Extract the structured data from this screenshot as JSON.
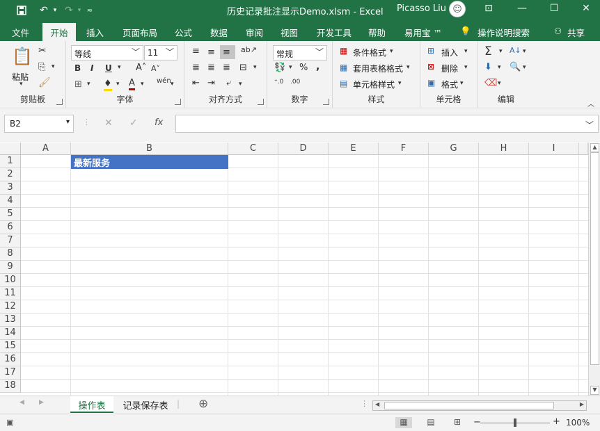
{
  "window": {
    "title": "历史记录批注显示Demo.xlsm  -  Excel",
    "user": "Picasso Liu",
    "controls": [
      "⊡",
      "—",
      "☐",
      "✕"
    ]
  },
  "qat": {
    "save_icon": "save-icon",
    "undo_icon": "undo-icon",
    "redo_icon": "redo-icon",
    "customize_icon": "customize-icon"
  },
  "menu": {
    "file": "文件",
    "home": "开始",
    "insert": "插入",
    "layout": "页面布局",
    "formulas": "公式",
    "data": "数据",
    "review": "审阅",
    "view": "视图",
    "developer": "开发工具",
    "help": "帮助",
    "yiyongbao": "易用宝 ™",
    "tellme": "操作说明搜索",
    "share": "共享"
  },
  "ribbon": {
    "clipboard": {
      "label": "剪贴板",
      "paste": "粘贴"
    },
    "font": {
      "label": "字体",
      "name": "等线",
      "size": "11"
    },
    "alignment": {
      "label": "对齐方式"
    },
    "number": {
      "label": "数字",
      "format": "常规"
    },
    "styles": {
      "label": "样式",
      "cond": "条件格式",
      "table": "套用表格格式",
      "cell": "单元格样式"
    },
    "cells": {
      "label": "单元格",
      "insert": "插入",
      "delete": "删除",
      "format": "格式"
    },
    "editing": {
      "label": "编辑"
    }
  },
  "formula_bar": {
    "name_box": "B2",
    "fx": "fx",
    "cancel": "✕",
    "enter": "✓",
    "content": ""
  },
  "columns": [
    "A",
    "B",
    "C",
    "D",
    "E",
    "F",
    "G",
    "H",
    "I"
  ],
  "rows": [
    "1",
    "2",
    "3",
    "4",
    "5",
    "6",
    "7",
    "8",
    "9",
    "10",
    "11",
    "12",
    "13",
    "14",
    "15",
    "16",
    "17",
    "18"
  ],
  "cells": {
    "B1": "最新服务"
  },
  "sheets": {
    "tab1": "操作表",
    "tab2": "记录保存表",
    "add": "⊕"
  },
  "status": {
    "zoom": "100%",
    "minus": "−",
    "plus": "+"
  },
  "colors": {
    "accent": "#217346",
    "header_fill": "#4472c4"
  }
}
